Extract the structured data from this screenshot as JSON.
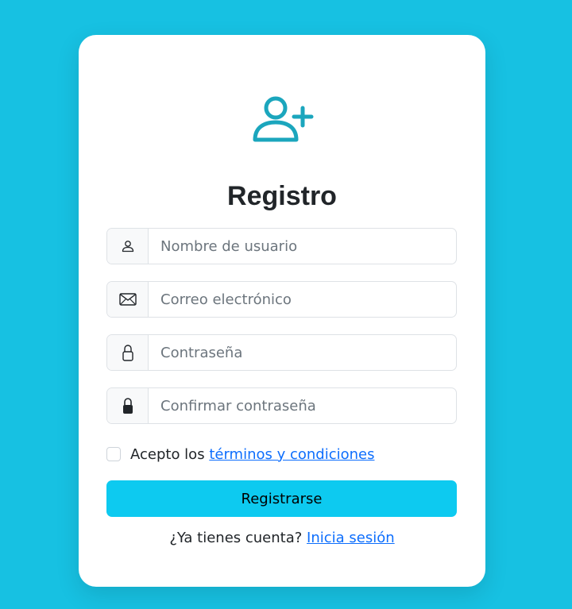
{
  "colors": {
    "background": "#17c1e2",
    "card": "#ffffff",
    "accent_icon": "#1ba6bd",
    "button": "#0dcaf0",
    "link": "#0d6efd"
  },
  "header": {
    "icon": "person-add-icon",
    "title": "Registro"
  },
  "form": {
    "username": {
      "icon": "person-icon",
      "placeholder": "Nombre de usuario",
      "value": ""
    },
    "email": {
      "icon": "envelope-icon",
      "placeholder": "Correo electrónico",
      "value": ""
    },
    "password": {
      "icon": "lock-outline-icon",
      "placeholder": "Contraseña",
      "value": ""
    },
    "confirm_password": {
      "icon": "lock-filled-icon",
      "placeholder": "Confirmar contraseña",
      "value": ""
    },
    "terms": {
      "checked": false,
      "prefix": "Acepto los",
      "link_text": "términos y condiciones"
    },
    "submit_label": "Registrarse"
  },
  "footer": {
    "prompt": "¿Ya tienes cuenta?",
    "link_text": "Inicia sesión"
  }
}
